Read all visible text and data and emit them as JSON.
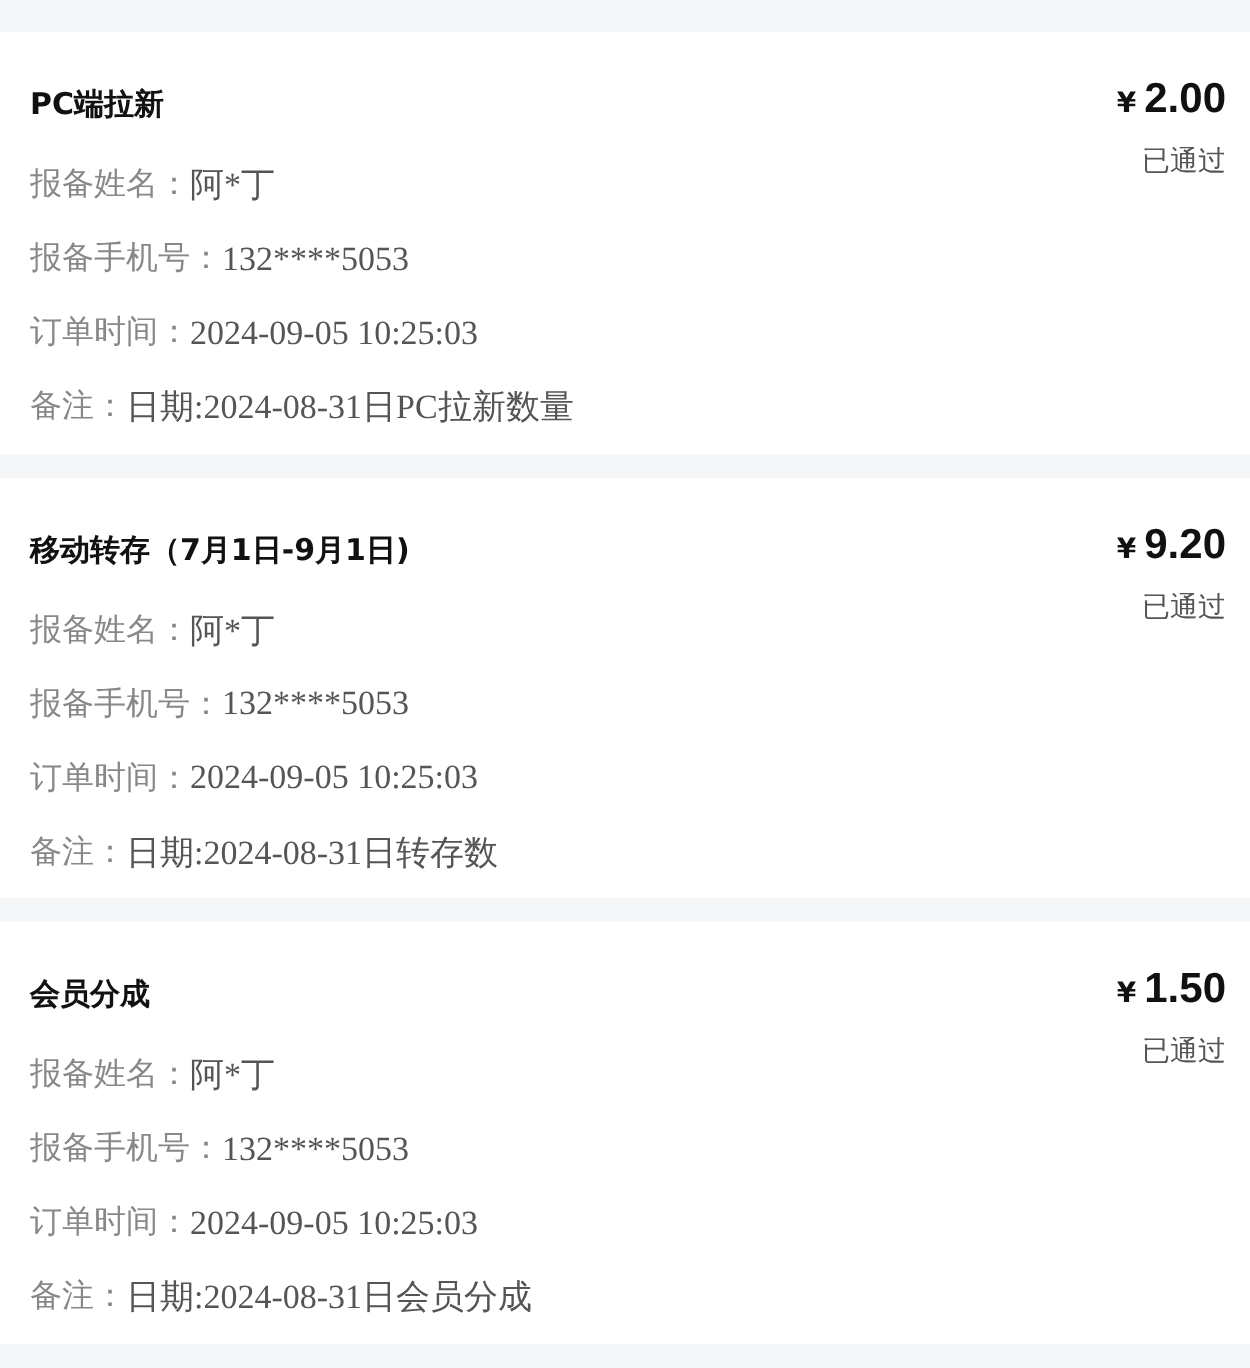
{
  "orders": [
    {
      "title": "PC端拉新",
      "currency": "¥",
      "amount": "2.00",
      "status": "已通过",
      "fields": [
        {
          "label": "报备姓名：",
          "value": "阿*丁"
        },
        {
          "label": "报备手机号：",
          "value": "132****5053"
        },
        {
          "label": "订单时间：",
          "value": "2024-09-05 10:25:03"
        },
        {
          "label": "备注：",
          "value": "日期:2024-08-31日PC拉新数量"
        }
      ]
    },
    {
      "title": "移动转存（7月1日-9月1日)",
      "currency": "¥",
      "amount": "9.20",
      "status": "已通过",
      "fields": [
        {
          "label": "报备姓名：",
          "value": "阿*丁"
        },
        {
          "label": "报备手机号：",
          "value": "132****5053"
        },
        {
          "label": "订单时间：",
          "value": "2024-09-05 10:25:03"
        },
        {
          "label": "备注：",
          "value": "日期:2024-08-31日转存数"
        }
      ]
    },
    {
      "title": "会员分成",
      "currency": "¥",
      "amount": "1.50",
      "status": "已通过",
      "fields": [
        {
          "label": "报备姓名：",
          "value": "阿*丁"
        },
        {
          "label": "报备手机号：",
          "value": "132****5053"
        },
        {
          "label": "订单时间：",
          "value": "2024-09-05 10:25:03"
        },
        {
          "label": "备注：",
          "value": "日期:2024-08-31日会员分成"
        }
      ]
    }
  ]
}
